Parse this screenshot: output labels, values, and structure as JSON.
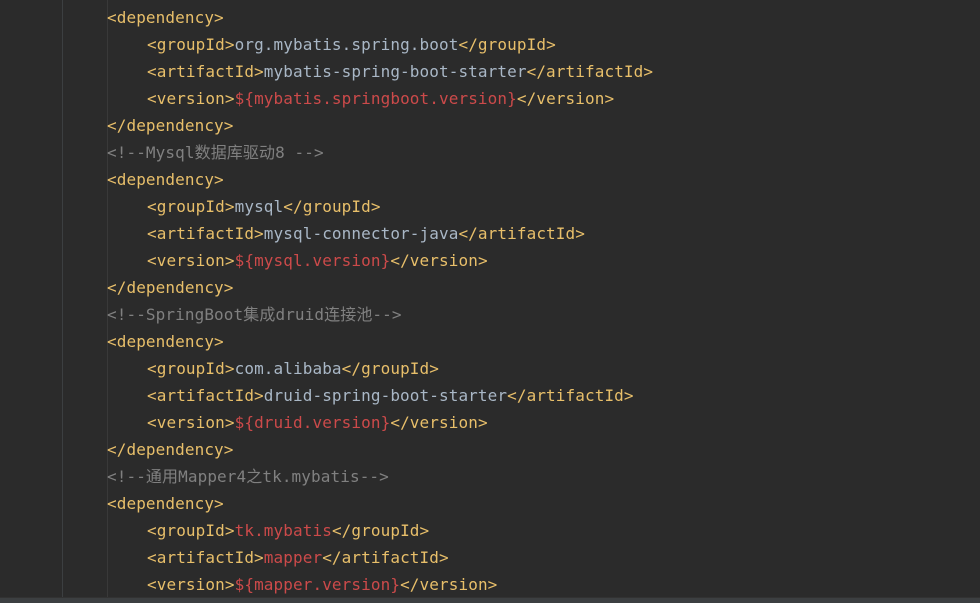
{
  "colors": {
    "background": "#2b2b2b",
    "tag": "#e8bf6a",
    "text": "#a9b7c6",
    "property": "#cc4a4a",
    "comment": "#808080"
  },
  "lines": [
    {
      "indent": 1,
      "segments": [
        {
          "kind": "tag",
          "text": "<dependency>"
        }
      ]
    },
    {
      "indent": 2,
      "segments": [
        {
          "kind": "tag",
          "text": "<groupId>"
        },
        {
          "kind": "text",
          "text": "org.mybatis.spring.boot"
        },
        {
          "kind": "tag",
          "text": "</groupId>"
        }
      ]
    },
    {
      "indent": 2,
      "segments": [
        {
          "kind": "tag",
          "text": "<artifactId>"
        },
        {
          "kind": "text",
          "text": "mybatis-spring-boot-starter"
        },
        {
          "kind": "tag",
          "text": "</artifactId>"
        }
      ]
    },
    {
      "indent": 2,
      "segments": [
        {
          "kind": "tag",
          "text": "<version>"
        },
        {
          "kind": "var",
          "text": "${mybatis.springboot.version}"
        },
        {
          "kind": "tag",
          "text": "</version>"
        }
      ]
    },
    {
      "indent": 1,
      "segments": [
        {
          "kind": "tag",
          "text": "</dependency>"
        }
      ]
    },
    {
      "indent": 1,
      "segments": [
        {
          "kind": "comment",
          "text": "<!--Mysql数据库驱动8 -->"
        }
      ]
    },
    {
      "indent": 1,
      "segments": [
        {
          "kind": "tag",
          "text": "<dependency>"
        }
      ]
    },
    {
      "indent": 2,
      "segments": [
        {
          "kind": "tag",
          "text": "<groupId>"
        },
        {
          "kind": "text",
          "text": "mysql"
        },
        {
          "kind": "tag",
          "text": "</groupId>"
        }
      ]
    },
    {
      "indent": 2,
      "segments": [
        {
          "kind": "tag",
          "text": "<artifactId>"
        },
        {
          "kind": "text",
          "text": "mysql-connector-java"
        },
        {
          "kind": "tag",
          "text": "</artifactId>"
        }
      ]
    },
    {
      "indent": 2,
      "segments": [
        {
          "kind": "tag",
          "text": "<version>"
        },
        {
          "kind": "var",
          "text": "${mysql.version}"
        },
        {
          "kind": "tag",
          "text": "</version>"
        }
      ]
    },
    {
      "indent": 1,
      "segments": [
        {
          "kind": "tag",
          "text": "</dependency>"
        }
      ]
    },
    {
      "indent": 1,
      "segments": [
        {
          "kind": "comment",
          "text": "<!--SpringBoot集成druid连接池-->"
        }
      ]
    },
    {
      "indent": 1,
      "segments": [
        {
          "kind": "tag",
          "text": "<dependency>"
        }
      ]
    },
    {
      "indent": 2,
      "segments": [
        {
          "kind": "tag",
          "text": "<groupId>"
        },
        {
          "kind": "text",
          "text": "com.alibaba"
        },
        {
          "kind": "tag",
          "text": "</groupId>"
        }
      ]
    },
    {
      "indent": 2,
      "segments": [
        {
          "kind": "tag",
          "text": "<artifactId>"
        },
        {
          "kind": "text",
          "text": "druid-spring-boot-starter"
        },
        {
          "kind": "tag",
          "text": "</artifactId>"
        }
      ]
    },
    {
      "indent": 2,
      "segments": [
        {
          "kind": "tag",
          "text": "<version>"
        },
        {
          "kind": "var",
          "text": "${druid.version}"
        },
        {
          "kind": "tag",
          "text": "</version>"
        }
      ]
    },
    {
      "indent": 1,
      "segments": [
        {
          "kind": "tag",
          "text": "</dependency>"
        }
      ]
    },
    {
      "indent": 1,
      "segments": [
        {
          "kind": "comment",
          "text": "<!--通用Mapper4之tk.mybatis-->"
        }
      ]
    },
    {
      "indent": 1,
      "segments": [
        {
          "kind": "tag",
          "text": "<dependency>"
        }
      ]
    },
    {
      "indent": 2,
      "segments": [
        {
          "kind": "tag",
          "text": "<groupId>"
        },
        {
          "kind": "var",
          "text": "tk.mybatis"
        },
        {
          "kind": "tag",
          "text": "</groupId>"
        }
      ]
    },
    {
      "indent": 2,
      "segments": [
        {
          "kind": "tag",
          "text": "<artifactId>"
        },
        {
          "kind": "var",
          "text": "mapper"
        },
        {
          "kind": "tag",
          "text": "</artifactId>"
        }
      ]
    },
    {
      "indent": 2,
      "segments": [
        {
          "kind": "tag",
          "text": "<version>"
        },
        {
          "kind": "var",
          "text": "${mapper.version}"
        },
        {
          "kind": "tag",
          "text": "</version>"
        }
      ]
    }
  ]
}
